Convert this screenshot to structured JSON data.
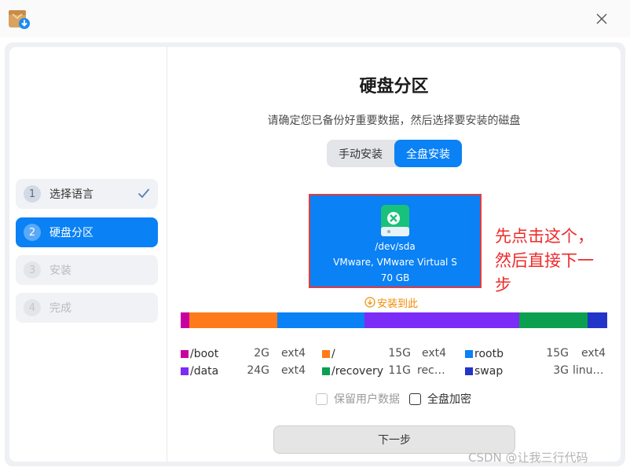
{
  "title": "硬盘分区",
  "subtitle": "请确定您已备份好重要数据，然后选择要安装的磁盘",
  "mode_toggle": {
    "manual": "手动安装",
    "full": "全盘安装",
    "selected": "full"
  },
  "steps": [
    {
      "num": "1",
      "label": "选择语言",
      "state": "done"
    },
    {
      "num": "2",
      "label": "硬盘分区",
      "state": "active"
    },
    {
      "num": "3",
      "label": "安装",
      "state": "pending"
    },
    {
      "num": "4",
      "label": "完成",
      "state": "pending"
    }
  ],
  "disk": {
    "device": "/dev/sda",
    "model": "VMware, VMware Virtual S",
    "size": "70 GB",
    "selected": true
  },
  "install_here": "安装到此",
  "annotation": {
    "line1": "先点击这个，",
    "line2": "然后直接下一",
    "line3": "步"
  },
  "partitions": [
    {
      "name": "/boot",
      "size": "2G",
      "fs": "ext4",
      "color": "#c800a0",
      "size_gb": 1.5
    },
    {
      "name": "/",
      "size": "15G",
      "fs": "ext4",
      "color": "#ff7a1a",
      "size_gb": 15
    },
    {
      "name": "rootb",
      "size": "15G",
      "fs": "ext4",
      "color": "#0a81f5",
      "size_gb": 15
    },
    {
      "name": "/data",
      "size": "24G",
      "fs": "ext4",
      "color": "#7b2cf6",
      "size_gb": 26.5
    },
    {
      "name": "/recovery",
      "size": "11G",
      "fs": "rec…",
      "color": "#0aa050",
      "size_gb": 11.7
    },
    {
      "name": "swap",
      "size": "3G",
      "fs": "linu…",
      "color": "#2334c8",
      "size_gb": 3.3
    }
  ],
  "options": {
    "keep_user_data": "保留用户数据",
    "full_disk_encrypt": "全盘加密"
  },
  "next_button": "下一步",
  "watermark": "CSDN @让我三行代码",
  "icons": {
    "app": "installer-icon",
    "close": "close-icon",
    "check": "check-icon",
    "disk": "disk-icon",
    "arrow": "down-arrow-circle-icon"
  }
}
